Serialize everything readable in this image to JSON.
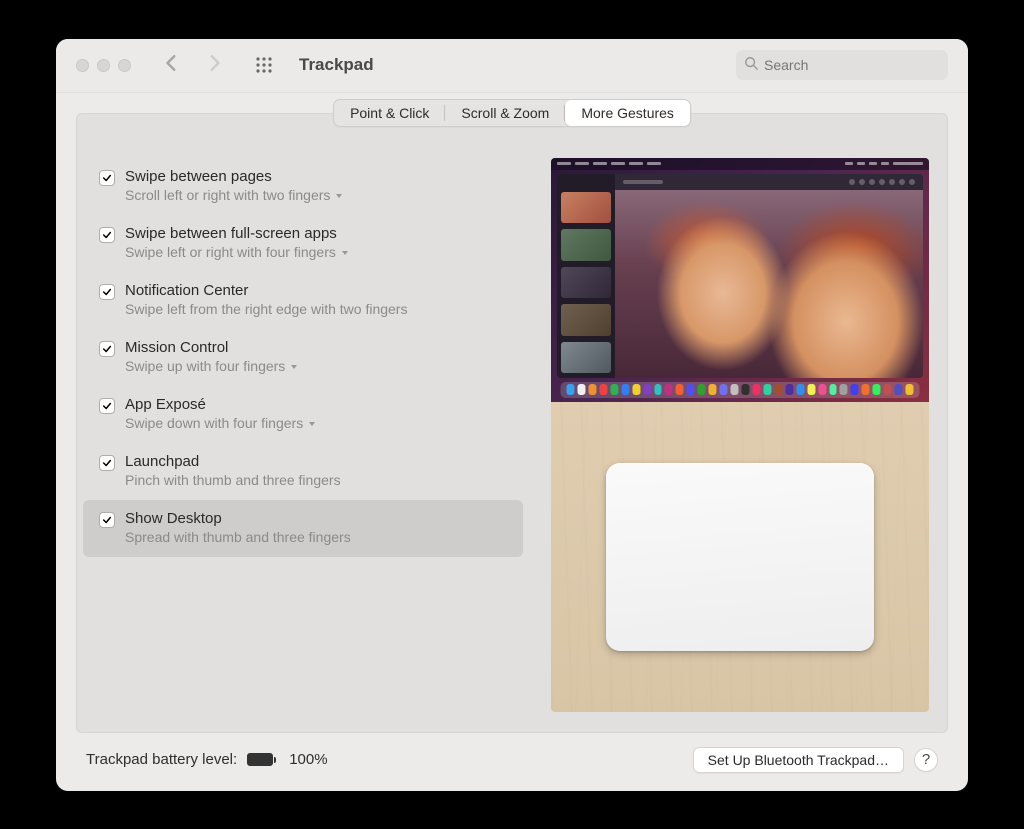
{
  "window_title": "Trackpad",
  "search_placeholder": "Search",
  "tabs": {
    "point_click": "Point & Click",
    "scroll_zoom": "Scroll & Zoom",
    "more_gestures": "More Gestures"
  },
  "active_tab": "more_gestures",
  "options": [
    {
      "id": "swipe-pages",
      "title": "Swipe between pages",
      "subtitle": "Scroll left or right with two fingers",
      "checked": true,
      "has_dropdown": true,
      "selected": false
    },
    {
      "id": "swipe-fullscreen",
      "title": "Swipe between full-screen apps",
      "subtitle": "Swipe left or right with four fingers",
      "checked": true,
      "has_dropdown": true,
      "selected": false
    },
    {
      "id": "notification-center",
      "title": "Notification Center",
      "subtitle": "Swipe left from the right edge with two fingers",
      "checked": true,
      "has_dropdown": false,
      "selected": false
    },
    {
      "id": "mission-control",
      "title": "Mission Control",
      "subtitle": "Swipe up with four fingers",
      "checked": true,
      "has_dropdown": true,
      "selected": false
    },
    {
      "id": "app-expose",
      "title": "App Exposé",
      "subtitle": "Swipe down with four fingers",
      "checked": true,
      "has_dropdown": true,
      "selected": false
    },
    {
      "id": "launchpad",
      "title": "Launchpad",
      "subtitle": "Pinch with thumb and three fingers",
      "checked": true,
      "has_dropdown": false,
      "selected": false
    },
    {
      "id": "show-desktop",
      "title": "Show Desktop",
      "subtitle": "Spread with thumb and three fingers",
      "checked": true,
      "has_dropdown": false,
      "selected": true
    }
  ],
  "footer": {
    "battery_label": "Trackpad battery level:",
    "battery_pct": "100%",
    "bluetooth_button": "Set Up Bluetooth Trackpad…",
    "help_label": "?"
  },
  "dock_colors": [
    "#3aa0f0",
    "#f0f0f0",
    "#f09030",
    "#f04040",
    "#30b050",
    "#3080f0",
    "#f0d030",
    "#8040c0",
    "#30c0c0",
    "#c03080",
    "#f06030",
    "#5050f0",
    "#30a030",
    "#f0b030",
    "#7070f0",
    "#c0c0c0",
    "#303030",
    "#f03060",
    "#30d0a0",
    "#a05030",
    "#5030a0",
    "#3090f0",
    "#f0f050",
    "#f05090",
    "#50f0a0",
    "#a0a0a0",
    "#4040f0",
    "#f07030",
    "#30f060",
    "#c05050",
    "#5050c0",
    "#f0c030"
  ]
}
